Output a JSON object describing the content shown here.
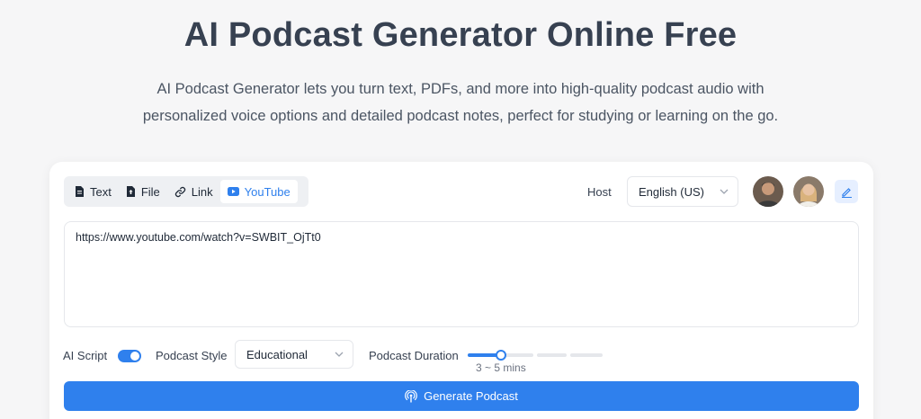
{
  "hero": {
    "title": "AI Podcast Generator Online Free",
    "description_line1": "AI Podcast Generator lets you turn text, PDFs, and more into high-quality podcast audio with",
    "description_line2": "personalized voice options and detailed podcast notes, perfect for studying or learning on the go."
  },
  "tabs": [
    {
      "label": "Text",
      "icon": "document-icon",
      "active": false
    },
    {
      "label": "File",
      "icon": "file-upload-icon",
      "active": false
    },
    {
      "label": "Link",
      "icon": "link-icon",
      "active": false
    },
    {
      "label": "YouTube",
      "icon": "youtube-icon",
      "active": true
    }
  ],
  "host": {
    "label": "Host",
    "language": "English (US)",
    "avatars": [
      "host-avatar-male",
      "host-avatar-female"
    ]
  },
  "input": {
    "url": "https://www.youtube.com/watch?v=SWBIT_OjTt0"
  },
  "options": {
    "ai_script_label": "AI Script",
    "ai_script_enabled": true,
    "style_label": "Podcast Style",
    "style_value": "Educational",
    "duration_label": "Podcast Duration",
    "duration_value": "3 ~ 5 mins",
    "duration_step": 1,
    "duration_steps_total": 4
  },
  "generate": {
    "label": "Generate Podcast"
  },
  "colors": {
    "accent": "#2f80ed",
    "accent_light": "#e6efff",
    "title": "#374151"
  }
}
